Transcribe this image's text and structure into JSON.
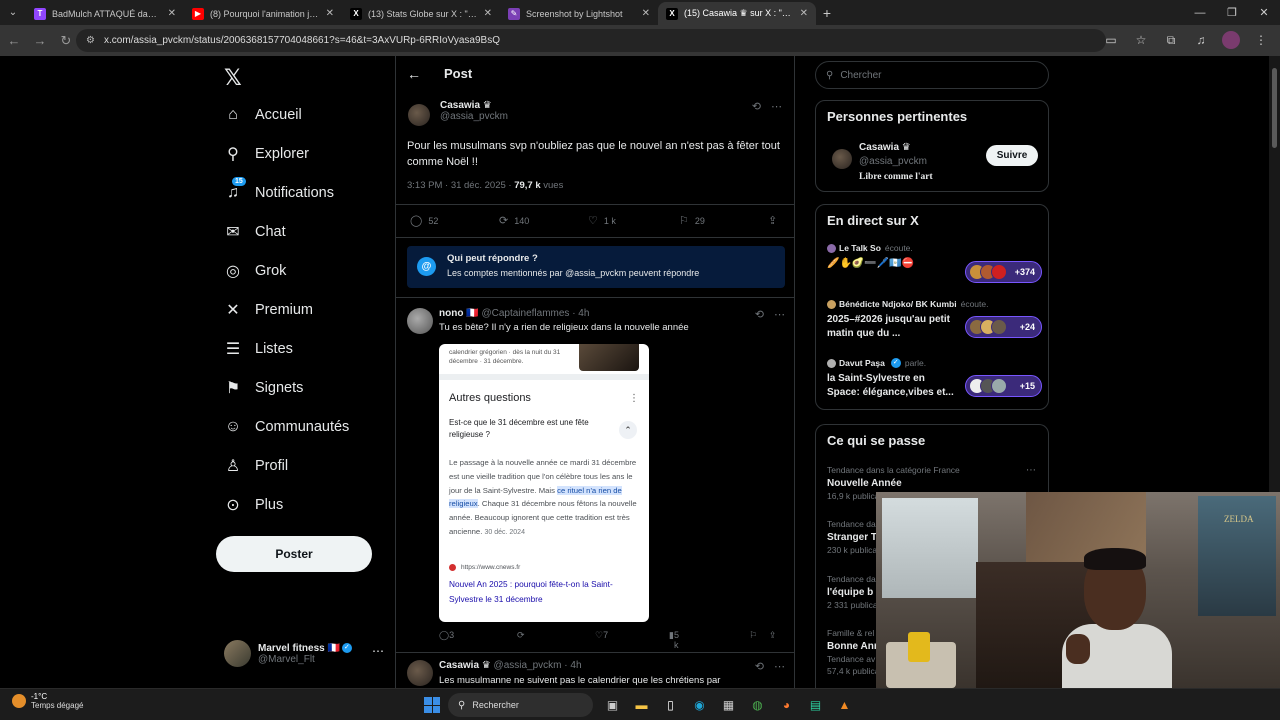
{
  "browser": {
    "tabs": [
      {
        "title": "BadMulch ATTAQUÉ dans LIBÉ",
        "fav": "T",
        "fav_color": "#9146ff"
      },
      {
        "title": "(8) Pourquoi l'animation japona",
        "fav": "▶",
        "fav_color": "#ff0000"
      },
      {
        "title": "(13) Stats Globe sur X : \"Year W",
        "fav": "X",
        "fav_color": "#000000"
      },
      {
        "title": "Screenshot by Lightshot",
        "fav": "✎",
        "fav_color": "#7b3fb5"
      },
      {
        "title": "(15) Casawia ♛ sur X : \"Pour le",
        "fav": "X",
        "fav_color": "#000000"
      }
    ],
    "url": "x.com/assia_pvckm/status/2006368157704048661?s=46&t=3AxVURp-6RRIoVyasa9BsQ"
  },
  "nav": {
    "items": [
      {
        "label": "Accueil",
        "icon": "home-icon",
        "glyph": "⌂"
      },
      {
        "label": "Explorer",
        "icon": "search-icon",
        "glyph": "⚲"
      },
      {
        "label": "Notifications",
        "icon": "bell-icon",
        "glyph": "🔔"
      },
      {
        "label": "Chat",
        "icon": "mail-icon",
        "glyph": "✉"
      },
      {
        "label": "Grok",
        "icon": "grok-icon",
        "glyph": "◎"
      },
      {
        "label": "Premium",
        "icon": "x-icon",
        "glyph": "𝕏"
      },
      {
        "label": "Listes",
        "icon": "list-icon",
        "glyph": "☰"
      },
      {
        "label": "Signets",
        "icon": "bookmark-icon",
        "glyph": "⚑"
      },
      {
        "label": "Communautés",
        "icon": "people-icon",
        "glyph": "👥"
      },
      {
        "label": "Profil",
        "icon": "user-icon",
        "glyph": "👤"
      },
      {
        "label": "Plus",
        "icon": "more-icon",
        "glyph": "⋯"
      }
    ],
    "notif_badge": "15",
    "post_button": "Poster",
    "profile": {
      "name": "Marvel fitness 🇫🇷",
      "handle": "@Marvel_Flt"
    }
  },
  "main": {
    "header": "Post",
    "tweet": {
      "author": "Casawia ♛",
      "handle": "@assia_pvckm",
      "text": "Pour les musulmans svp n'oubliez pas que le nouvel an n'est pas à fêter tout comme Noël !!",
      "time": "3:13 PM · 31 déc. 2025 · ",
      "views_count": "79,7 k",
      "views_label": " vues",
      "replies": "52",
      "reposts": "140",
      "likes": "1 k",
      "bookmarks": "29"
    },
    "reply_notice": {
      "title": "Qui peut répondre ?",
      "subtitle": "Les comptes mentionnés par @assia_pvckm peuvent répondre"
    },
    "reply1": {
      "name": "nono 🇫🇷",
      "handle": " @Captaineflammes · 4h",
      "text": "Tu es bête? Il n'y a rien de religieux dans la nouvelle année",
      "embed": {
        "top": "calendrier grégorien · dès la nuit du 31 décembre · 31 décembre.",
        "title": "Autres questions",
        "question": "Est-ce que le 31 décembre est une fête religieuse ?",
        "body_before": "Le passage à la nouvelle année ce mardi 31 décembre est une vieille tradition que l'on célèbre tous les ans le jour de la Saint-Sylvestre. Mais ",
        "body_highlight": "ce rituel n'a rien de religieux",
        "body_after": ". Chaque 31 décembre nous fêtons la nouvelle année. Beaucoup ignorent que cette tradition est très ancienne. ",
        "date": "30 déc. 2024",
        "source": "https://www.cnews.fr",
        "link": "Nouvel An 2025 : pourquoi fête-t-on la Saint-Sylvestre le 31 décembre"
      },
      "replies": "3",
      "likes": "7",
      "views": "5 k"
    },
    "reply2": {
      "name": "Casawia ♛",
      "handle": " @assia_pvckm · 4h",
      "text": "Les musulmanne ne suivent pas le calendrier que les chrétiens par"
    }
  },
  "right": {
    "search_placeholder": "Chercher",
    "pertinent": {
      "title": "Personnes pertinentes",
      "name": "Casawia ♛",
      "handle": "@assia_pvckm",
      "bio": "Libre comme l'art",
      "follow": "Suivre"
    },
    "live": {
      "title": "En direct sur X",
      "items": [
        {
          "host": "Le Talk So",
          "action": "écoute.",
          "title": "🥖✋🥑➖🖊️🇬🇹⛔",
          "count": "+374"
        },
        {
          "host": "Bénédicte Ndjoko/ BK Kumbi",
          "action": "écoute.",
          "title": "2025–#2026 jusqu'au petit matin que du ...",
          "count": "+24"
        },
        {
          "host": "Davut Paşa",
          "action": "parle.",
          "title": "la Saint-Sylvestre en Space: élégance,vibes et...",
          "count": "+15"
        }
      ]
    },
    "trends": {
      "title": "Ce qui se passe",
      "items": [
        {
          "cat": "Tendance dans la catégorie France",
          "name": "Nouvelle Année",
          "count": "16,9 k publicati"
        },
        {
          "cat": "Tendance da",
          "name": "Stranger T",
          "count": "230 k publicat"
        },
        {
          "cat": "Tendance da",
          "name": "l'équipe b",
          "count": "2 331 publicat"
        },
        {
          "cat": "Famille & rel",
          "name": "Bonne Ann",
          "count": "Tendance av"
        },
        {
          "cat": "",
          "name": "",
          "count": "57,4 k publicat"
        }
      ]
    }
  },
  "taskbar": {
    "temp": "-1°C",
    "weather": "Temps dégagé",
    "search": "Rechercher"
  }
}
